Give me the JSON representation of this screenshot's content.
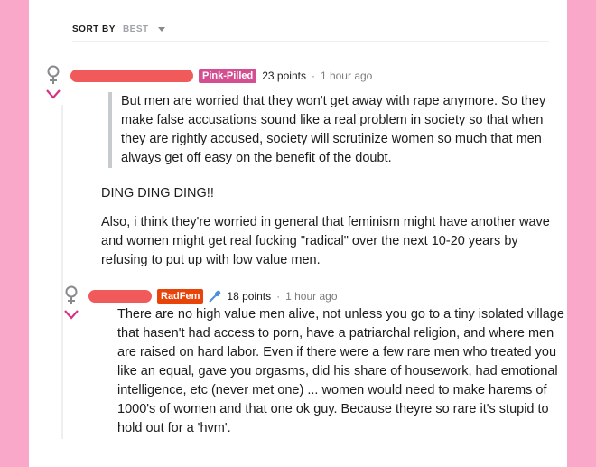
{
  "sort": {
    "label": "SORT BY",
    "value": "BEST"
  },
  "comments": [
    {
      "flair": "Pink-Pilled",
      "points": "23 points",
      "separator": "·",
      "time": "1 hour ago",
      "quote": "But men are worried that they won't get away with rape anymore. So they make false accusations sound like a real problem in society so that when they are rightly accused, society will scrutinize women so much that men always get off easy on the benefit of the doubt.",
      "paragraphs": [
        "DING DING DING!!",
        "Also, i think they're worried in general that feminism might have another wave and women might get real fucking \"radical\" over the next 10-20 years by refusing to put up with low value men."
      ]
    },
    {
      "flair": "RadFem",
      "points": "18 points",
      "separator": "·",
      "time": "1 hour ago",
      "body": "There are no high value men alive, not unless you go to a tiny isolated village that hasen't had access to porn, have a patriarchal religion, and where men are raised on hard labor. Even if there were a few rare men who treated you like an equal, gave you orgasms, did his share of housework, had emotional intelligence, etc (never met one) ... women would need to make harems of 1000's of women and that one ok guy. Because theyre so rare it's stupid to hold out for a 'hvm'."
    }
  ],
  "colors": {
    "page_background": "#f9a8c9",
    "redaction": "#f05a5a",
    "flair_pink": "#d44f92",
    "flair_red": "#e8440a",
    "vote_pink": "#d63384"
  },
  "icons": [
    "female-symbol-icon",
    "downvote-chevron-icon",
    "microphone-icon",
    "caret-down-icon"
  ]
}
